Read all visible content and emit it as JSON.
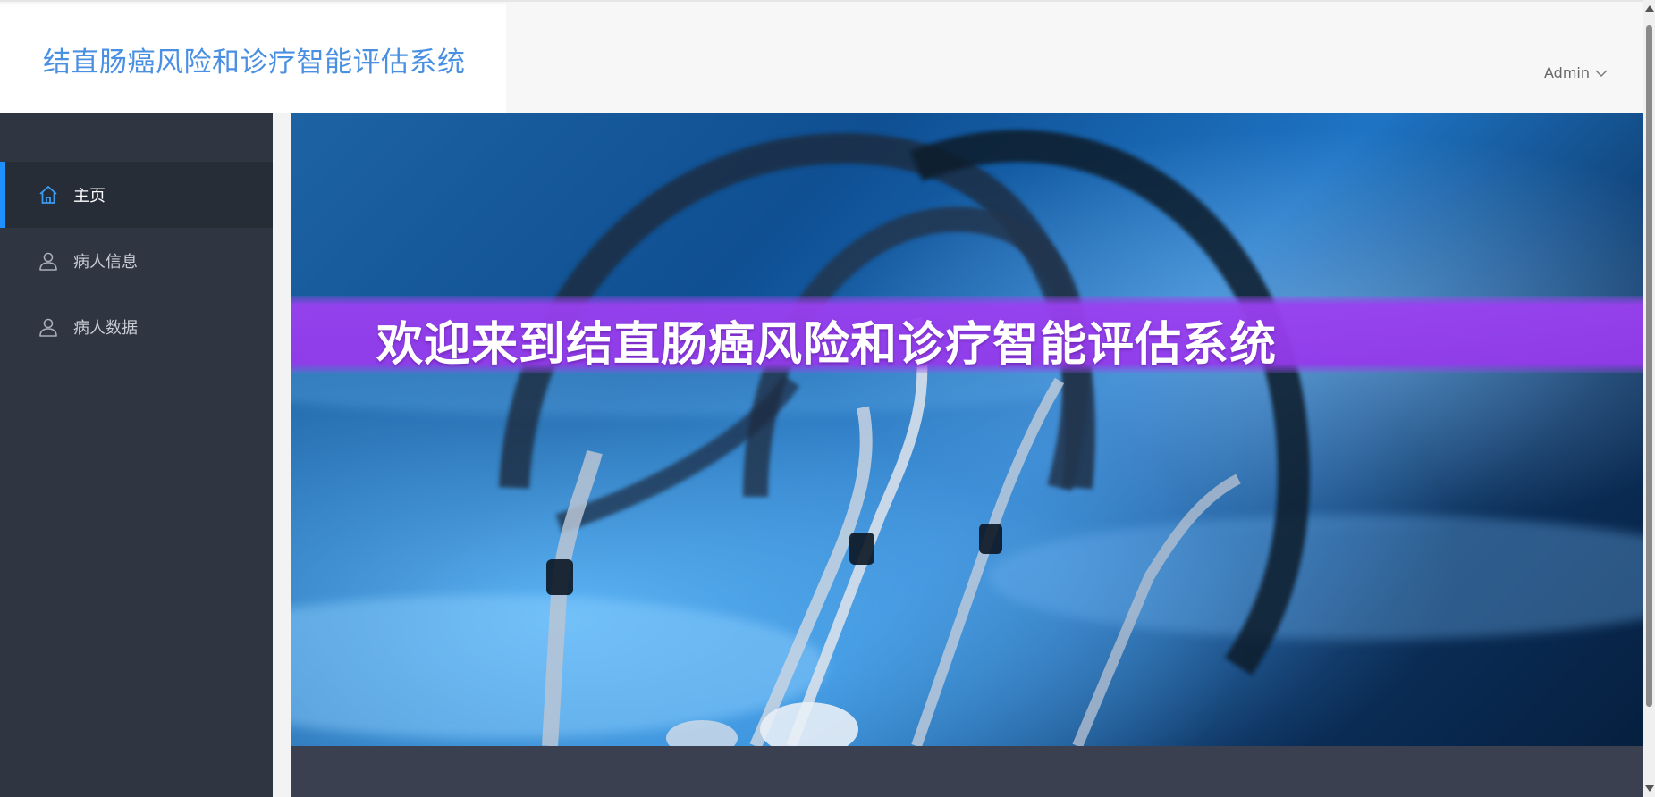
{
  "header": {
    "brand_title": "结直肠癌风险和诊疗智能评估系统",
    "user_label": "Admin",
    "user_icon": "chevron-down-icon"
  },
  "sidebar": {
    "items": [
      {
        "label": "主页",
        "icon": "home-icon",
        "active": true
      },
      {
        "label": "病人信息",
        "icon": "user-icon",
        "active": false
      },
      {
        "label": "病人数据",
        "icon": "user-icon",
        "active": false
      }
    ]
  },
  "main": {
    "welcome_text": "欢迎来到结直肠癌风险和诊疗智能评估系统"
  },
  "colors": {
    "brand": "#4a90e2",
    "sidebar_bg": "#2f3541",
    "active_accent": "#1e90ff",
    "banner": "#9a40f0",
    "footer_bg": "#3b4050"
  }
}
